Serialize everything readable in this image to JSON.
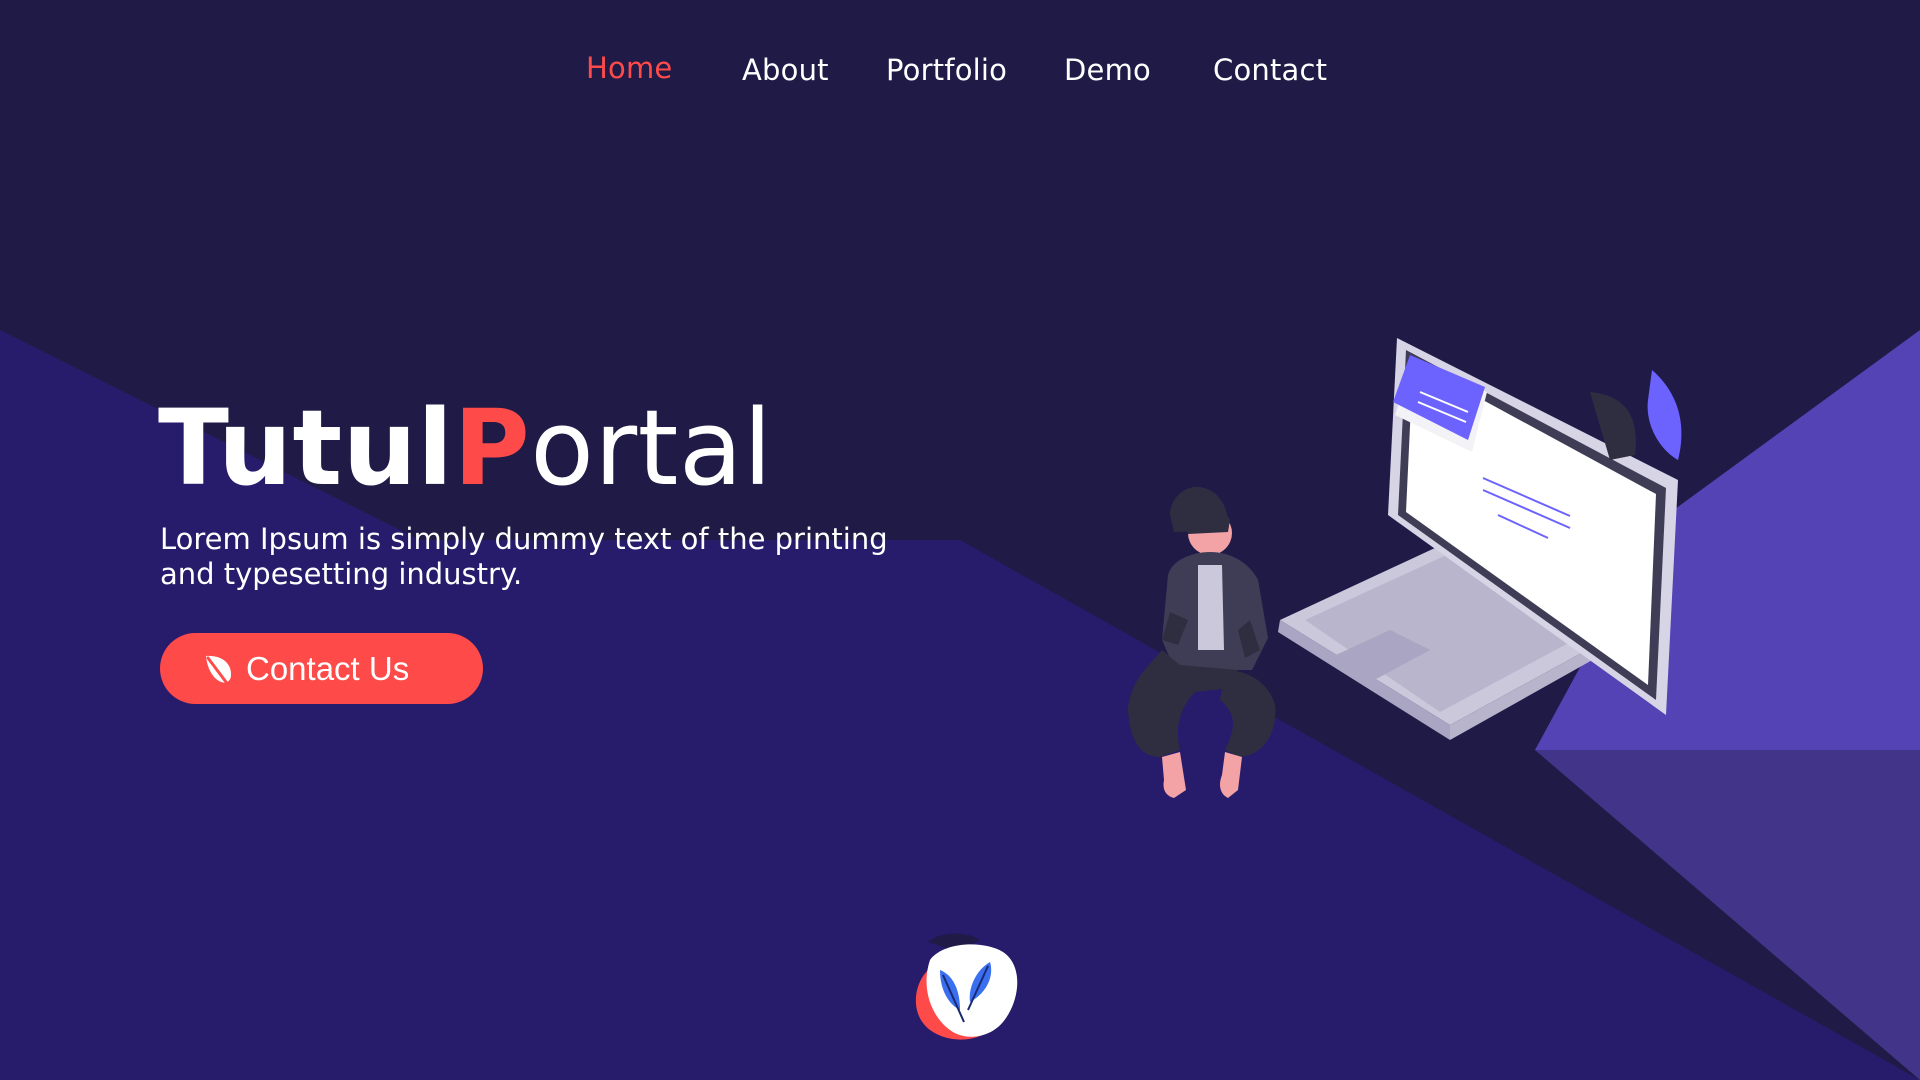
{
  "nav": {
    "items": [
      {
        "label": "Home",
        "active": true
      },
      {
        "label": "About"
      },
      {
        "label": "Portfolio"
      },
      {
        "label": "Demo"
      },
      {
        "label": "Contact"
      }
    ]
  },
  "hero": {
    "title_part1": "Tutul",
    "title_accent": "P",
    "title_part2": "ortal",
    "subtitle": "Lorem Ipsum is simply dummy text of the printing and typesetting industry.",
    "cta_label": "Contact Us",
    "cta_icon": "leaf-icon"
  },
  "illustration": {
    "subject": "woman-sitting-on-laptop-illustration"
  },
  "logo": {
    "icon": "feather-logo-icon"
  },
  "colors": {
    "background_dark": "#201a47",
    "background_band": "#271b6b",
    "accent_red": "#ff4a4a",
    "accent_purple": "#5443b5",
    "leaf_purple": "#6c63ff",
    "text_white": "#ffffff"
  }
}
